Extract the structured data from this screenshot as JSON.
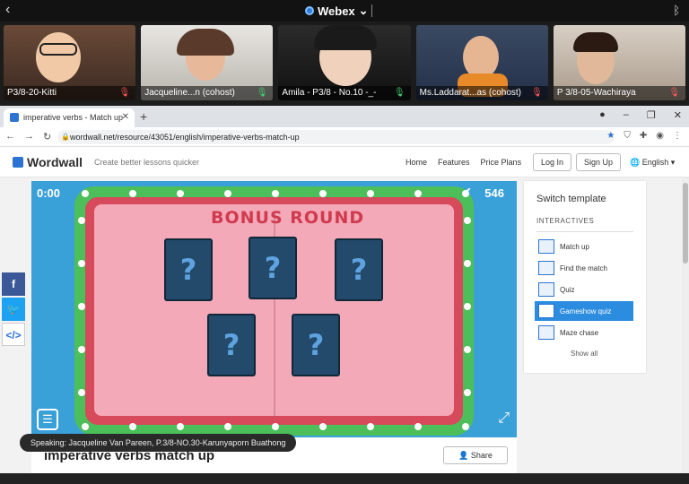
{
  "webex": {
    "title": "Webex",
    "back": "‹",
    "bluetooth": "ᛒ"
  },
  "participants": [
    {
      "name": "P3/8-20-Kitti",
      "mic": "muted"
    },
    {
      "name": "Jacqueline...n (cohost)",
      "mic": "active"
    },
    {
      "name": "Amila - P3/8 - No.10 -_-",
      "mic": "active"
    },
    {
      "name": "Ms.Laddarat...as (cohost)",
      "mic": "muted"
    },
    {
      "name": "P 3/8-05-Wachiraya",
      "mic": "muted"
    }
  ],
  "browser": {
    "tab_title": "imperative verbs - Match up",
    "url": "wordwall.net/resource/43051/english/imperative-verbs-match-up"
  },
  "wordwall": {
    "logo": "Wordwall",
    "tagline": "Create better lessons quicker",
    "nav": [
      "Home",
      "Features",
      "Price Plans"
    ],
    "login": "Log In",
    "signup": "Sign Up",
    "language": "English"
  },
  "game": {
    "timer": "0:00",
    "score": "546",
    "banner": "BONUS ROUND",
    "card_symbol": "?"
  },
  "activity": {
    "title": "imperative verbs match up",
    "share": "Share"
  },
  "speaking": "Speaking: Jacqueline Van Pareen, P.3/8-NO.30-Karunyaporn Buathong",
  "templates": {
    "title": "Switch template",
    "section": "INTERACTIVES",
    "items": [
      {
        "label": "Match up",
        "active": false
      },
      {
        "label": "Find the match",
        "active": false
      },
      {
        "label": "Quiz",
        "active": false
      },
      {
        "label": "Gameshow quiz",
        "active": true
      },
      {
        "label": "Maze chase",
        "active": false
      }
    ],
    "show_all": "Show all"
  },
  "colors": {
    "accent": "#2c8de0",
    "game_blue": "#3aa0d8",
    "frame_green": "#4cbf5a",
    "board_pink": "#f4a9b8"
  }
}
